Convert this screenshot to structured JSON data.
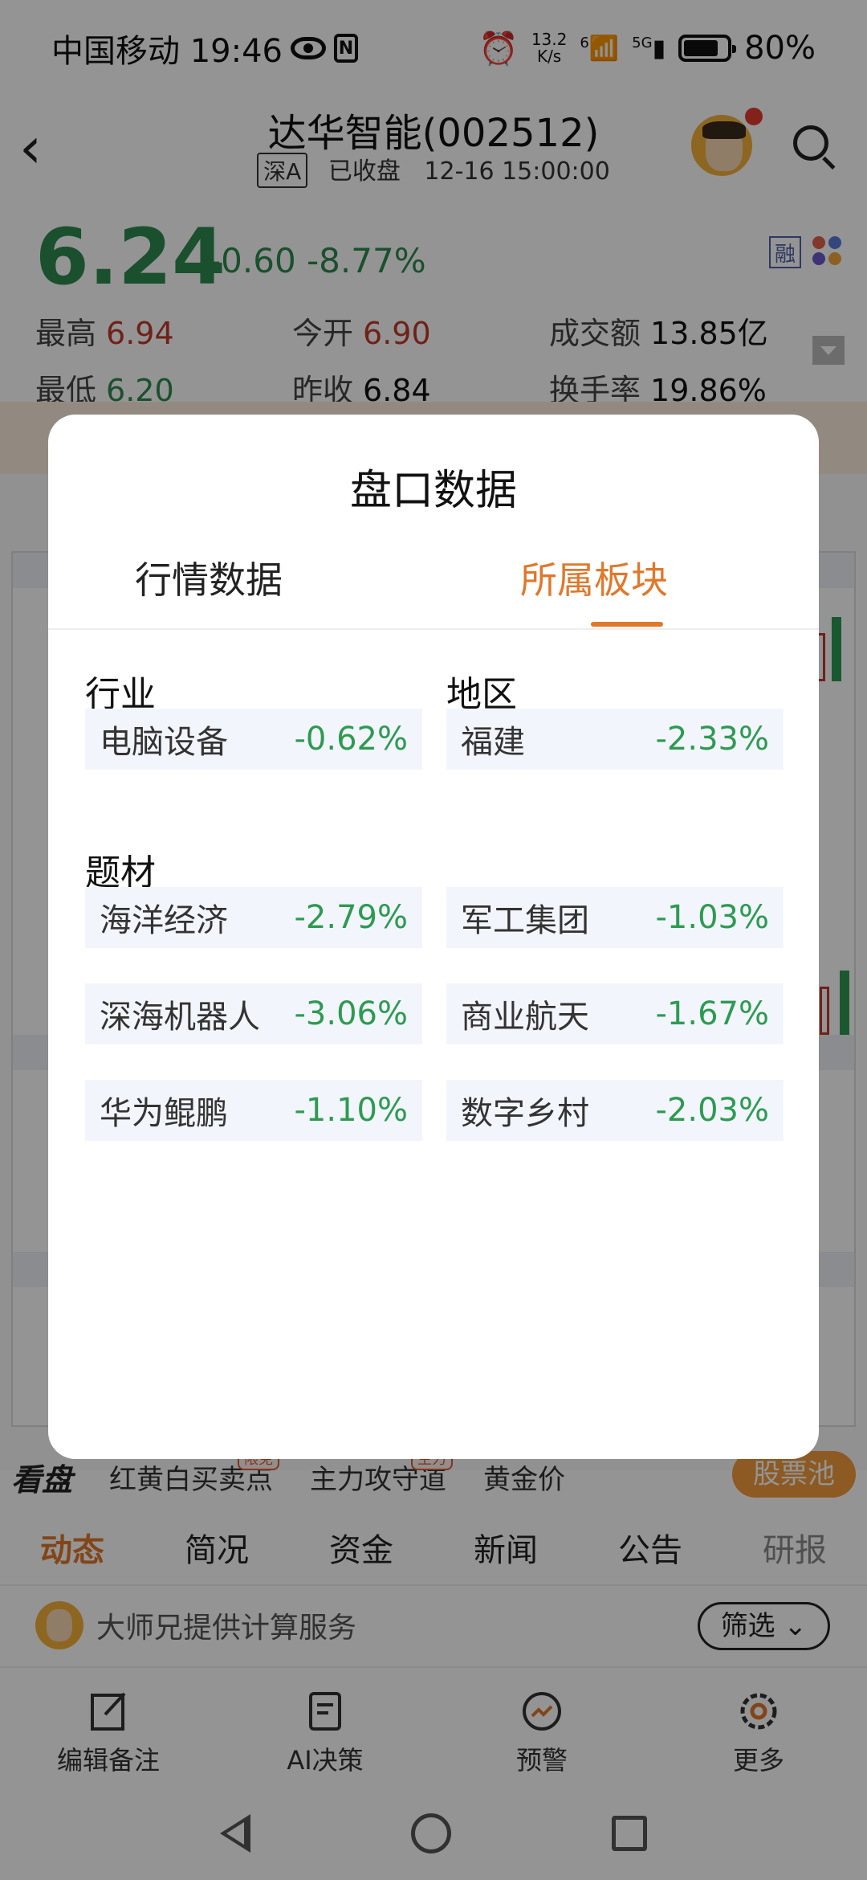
{
  "status_bar": {
    "carrier_time": "中国移动 19:46",
    "net_speed_value": "13.2",
    "net_speed_unit": "K/s",
    "wifi_label": "6",
    "signal_label": "5G",
    "battery": "80%",
    "icons": [
      "eye-icon",
      "nfc-icon",
      "alarm-icon",
      "wifi-icon",
      "signal-icon",
      "battery-icon"
    ]
  },
  "header": {
    "title": "达华智能(002512)",
    "market_tag": "深A",
    "status": "已收盘",
    "datetime": "12-16 15:00:00"
  },
  "quote": {
    "price": "6.24",
    "change": "-0.60",
    "change_pct": "-8.77%",
    "margin_tag": "融",
    "high_label": "最高",
    "high": "6.94",
    "open_label": "今开",
    "open": "6.90",
    "amount_label": "成交额",
    "amount": "13.85亿",
    "low_label": "最低",
    "low": "6.20",
    "prev_close_label": "昨收",
    "prev_close": "6.84",
    "turnover_label": "换手率",
    "turnover": "19.86%"
  },
  "kanpan": {
    "logo": "看盘",
    "items": [
      {
        "label": "红黄白买卖点",
        "tag": "限免"
      },
      {
        "label": "主力攻守道",
        "tag": "主力"
      },
      {
        "label": "黄金价"
      }
    ],
    "pool_button": "股票池"
  },
  "tabs": [
    "动态",
    "简况",
    "资金",
    "新闻",
    "公告",
    "研报"
  ],
  "feed": {
    "text": "大师兄提供计算服务",
    "filter_button": "筛选"
  },
  "bottom_bar": [
    {
      "label": "编辑备注",
      "icon": "edit-icon"
    },
    {
      "label": "AI决策",
      "icon": "document-icon"
    },
    {
      "label": "预警",
      "icon": "alert-icon"
    },
    {
      "label": "更多",
      "icon": "gear-icon"
    }
  ],
  "dialog": {
    "title": "盘口数据",
    "tabs": [
      {
        "label": "行情数据",
        "active": false
      },
      {
        "label": "所属板块",
        "active": true
      }
    ],
    "industry_label": "行业",
    "region_label": "地区",
    "industry": {
      "name": "电脑设备",
      "change": "-0.62%"
    },
    "region": {
      "name": "福建",
      "change": "-2.33%"
    },
    "theme_label": "题材",
    "themes": [
      {
        "name": "海洋经济",
        "change": "-2.79%"
      },
      {
        "name": "军工集团",
        "change": "-1.03%"
      },
      {
        "name": "深海机器人",
        "change": "-3.06%"
      },
      {
        "name": "商业航天",
        "change": "-1.67%"
      },
      {
        "name": "华为鲲鹏",
        "change": "-1.10%"
      },
      {
        "name": "数字乡村",
        "change": "-2.03%"
      }
    ]
  },
  "colors": {
    "accent": "#e0782c",
    "down": "#2e9a52",
    "up": "#c0392b"
  }
}
